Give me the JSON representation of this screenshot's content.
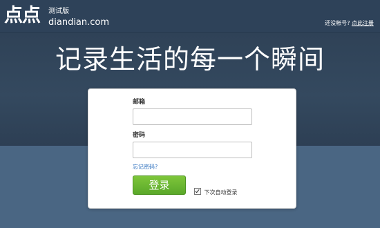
{
  "header": {
    "logo_text": "点点",
    "logo_sub": "测试版",
    "domain": "diandian.com",
    "no_account_text": "还没帐号?",
    "register_link": "点此注册"
  },
  "main": {
    "headline": "记录生活的每一个瞬间"
  },
  "login_form": {
    "email_label": "邮箱",
    "email_value": "",
    "password_label": "密码",
    "password_value": "",
    "forgot_link": "忘记密码?",
    "login_button": "登录",
    "remember_label": "下次自动登录",
    "remember_checked": true
  }
}
